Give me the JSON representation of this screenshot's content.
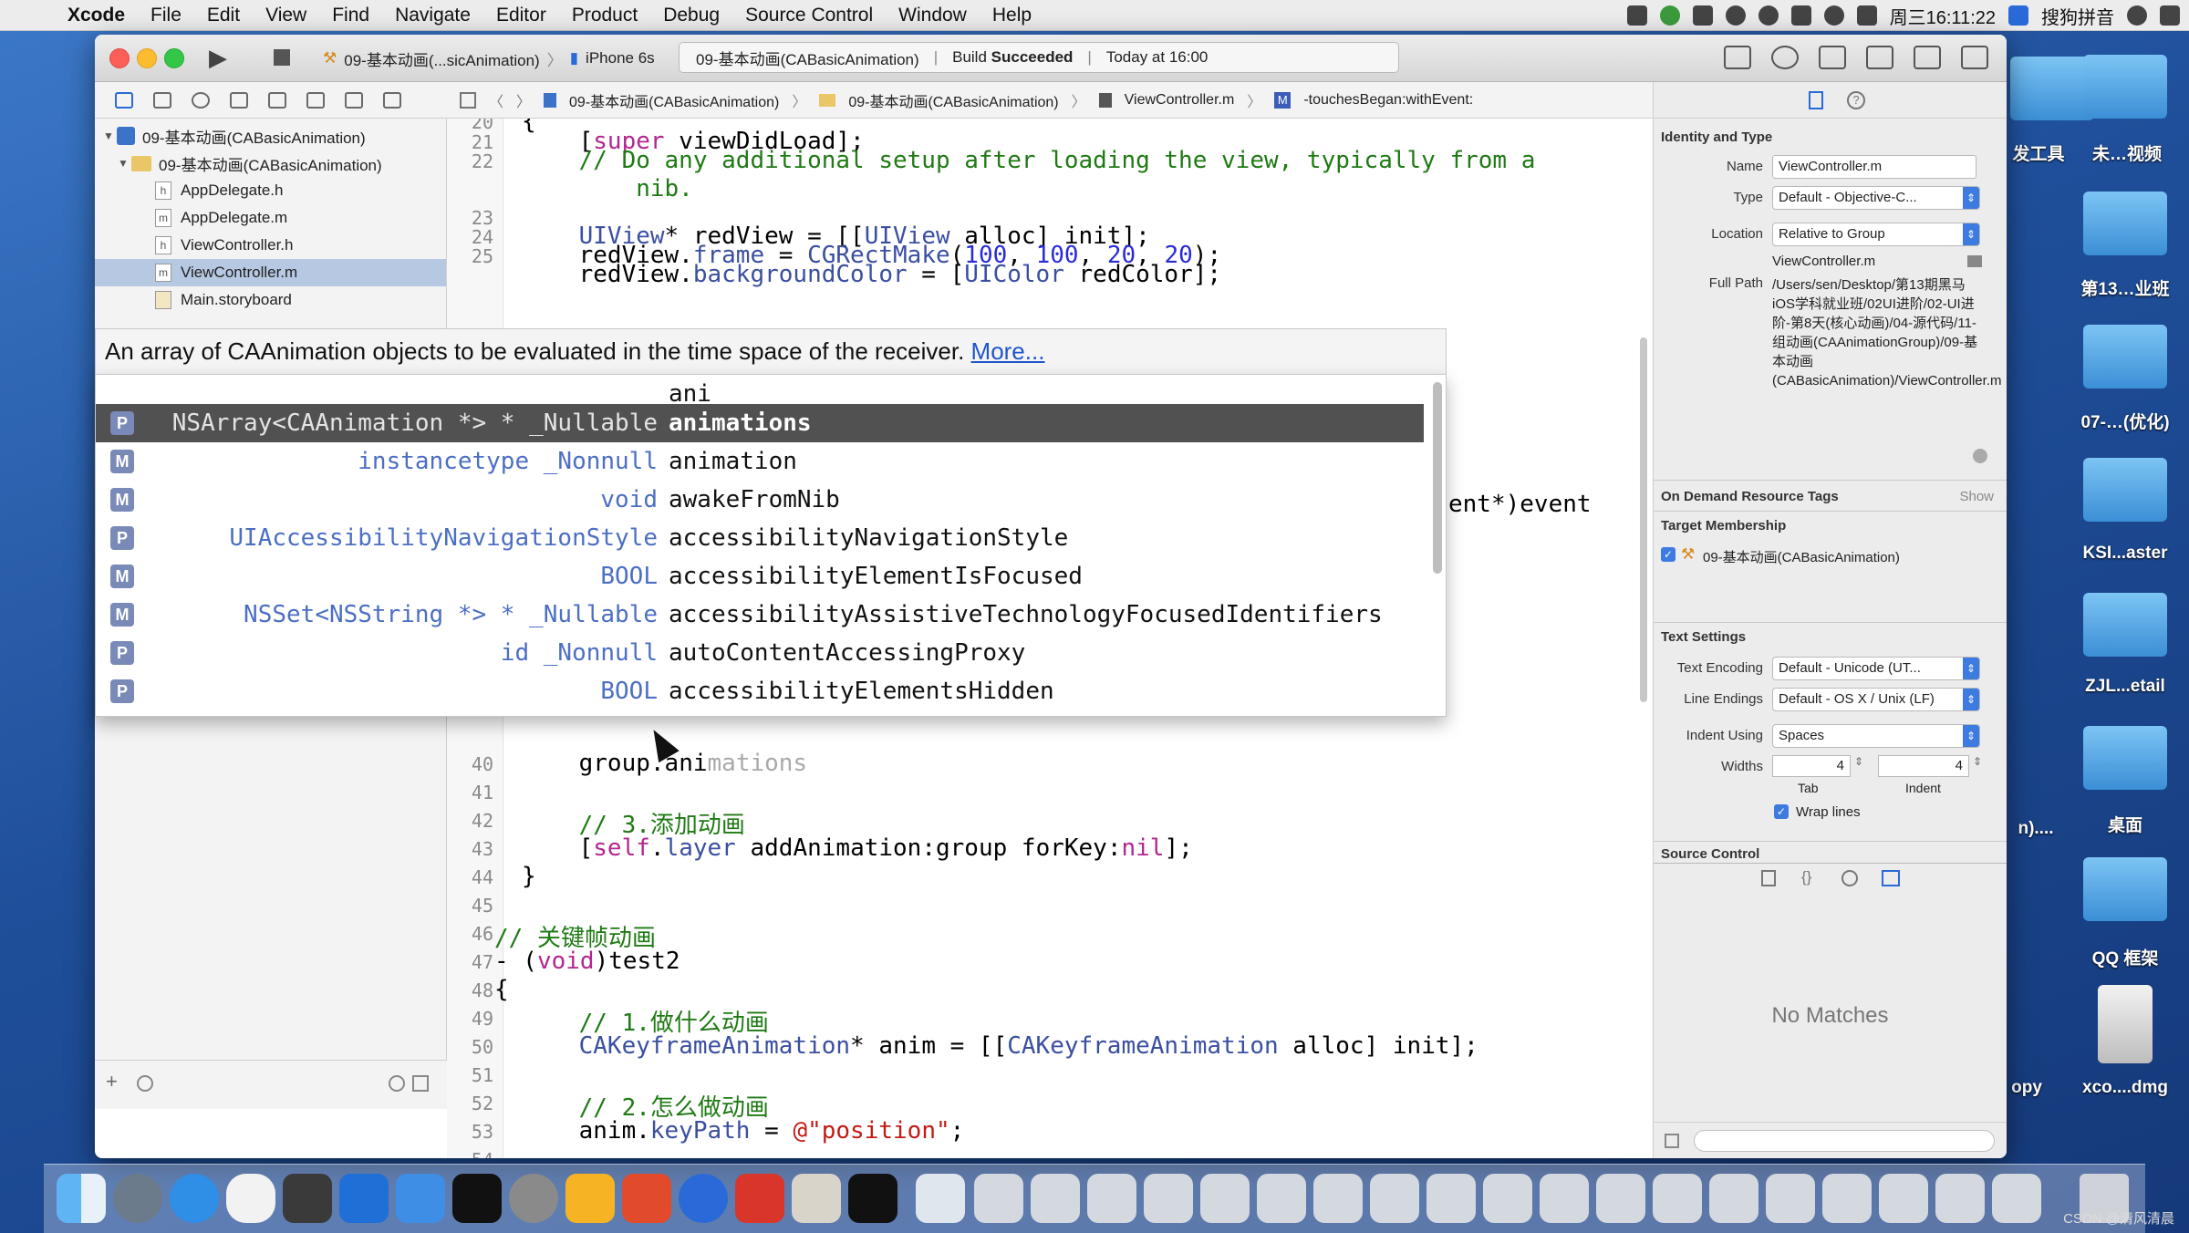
{
  "menubar": {
    "app": "Xcode",
    "items": [
      "File",
      "Edit",
      "View",
      "Find",
      "Navigate",
      "Editor",
      "Product",
      "Debug",
      "Source Control",
      "Window",
      "Help"
    ],
    "clock": "周三16:11:22",
    "input_method": "搜狗拼音"
  },
  "toolbar": {
    "scheme": "09-基本动画(...sicAnimation)",
    "device": "iPhone 6s",
    "activity_project": "09-基本动画(CABasicAnimation)",
    "activity_build": "Build",
    "activity_status": "Succeeded",
    "activity_time": "Today at 16:00"
  },
  "navigator": {
    "rows": [
      {
        "label": "09-基本动画(CABasicAnimation)",
        "kind": "project"
      },
      {
        "label": "09-基本动画(CABasicAnimation)",
        "kind": "folder"
      },
      {
        "label": "AppDelegate.h",
        "kind": "h"
      },
      {
        "label": "AppDelegate.m",
        "kind": "m"
      },
      {
        "label": "ViewController.h",
        "kind": "h"
      },
      {
        "label": "ViewController.m",
        "kind": "m"
      },
      {
        "label": "Main.storyboard",
        "kind": "sb"
      }
    ]
  },
  "jumpbar": {
    "crumbs": [
      "09-基本动画(CABasicAnimation)",
      "09-基本动画(CABasicAnimation)",
      "ViewController.m",
      "-touchesBegan:withEvent:"
    ]
  },
  "editor": {
    "line_numbers": [
      "20",
      "21",
      "22",
      "23",
      "24",
      "25",
      "40",
      "41",
      "42",
      "43",
      "44",
      "45",
      "46",
      "47",
      "48",
      "49",
      "50",
      "51",
      "52",
      "53",
      "54"
    ],
    "right_peek": "ent*)event",
    "line40_typed": "group.ani",
    "line40_ghost": "mations",
    "line42_comment": "// 3.添加动画",
    "line46_comment": "// 关键帧动画",
    "line49_comment": "// 1.做什么动画",
    "line52_comment": "// 2.怎么做动画"
  },
  "completion": {
    "help": "An array of CAAnimation objects to be evaluated in the time space of the receiver.",
    "help_link": "More...",
    "typed": "ani",
    "items": [
      {
        "kind": "P",
        "type": "NSArray<CAAnimation *> * _Nullable",
        "name": "animations"
      },
      {
        "kind": "M",
        "type": "instancetype _Nonnull",
        "name": "animation"
      },
      {
        "kind": "M",
        "type": "void",
        "name": "awakeFromNib"
      },
      {
        "kind": "P",
        "type": "UIAccessibilityNavigationStyle",
        "name": "accessibilityNavigationStyle"
      },
      {
        "kind": "M",
        "type": "BOOL",
        "name": "accessibilityElementIsFocused"
      },
      {
        "kind": "M",
        "type": "NSSet<NSString *> * _Nullable",
        "name": "accessibilityAssistiveTechnologyFocusedIdentifiers"
      },
      {
        "kind": "P",
        "type": "id _Nonnull",
        "name": "autoContentAccessingProxy"
      },
      {
        "kind": "P",
        "type": "BOOL",
        "name": "accessibilityElementsHidden"
      }
    ]
  },
  "inspector": {
    "identity_title": "Identity and Type",
    "name_label": "Name",
    "name_value": "ViewController.m",
    "type_label": "Type",
    "type_value": "Default - Objective-C...",
    "location_label": "Location",
    "location_value": "Relative to Group",
    "location_file": "ViewController.m",
    "fullpath_label": "Full Path",
    "fullpath_value": "/Users/sen/Desktop/第13期黑马iOS学科就业班/02UI进阶/02-UI进阶-第8天(核心动画)/04-源代码/11-组动画(CAAnimationGroup)/09-基本动画(CABasicAnimation)/ViewController.m",
    "ondemand_title": "On Demand Resource Tags",
    "ondemand_show": "Show",
    "target_title": "Target Membership",
    "target_item": "09-基本动画(CABasicAnimation)",
    "text_settings_title": "Text Settings",
    "encoding_label": "Text Encoding",
    "encoding_value": "Default - Unicode (UT...",
    "line_endings_label": "Line Endings",
    "line_endings_value": "Default - OS X / Unix (LF)",
    "indent_label": "Indent Using",
    "indent_value": "Spaces",
    "widths_label": "Widths",
    "tab_value": "4",
    "indent_width_value": "4",
    "tab_caption": "Tab",
    "indent_caption": "Indent",
    "wrap_label": "Wrap lines",
    "source_control_title": "Source Control",
    "no_matches": "No Matches"
  },
  "desktop": {
    "icons": [
      "发工具",
      "未…视频",
      "第13…业班",
      "07-…(优化)",
      "KSI...aster",
      "ZJL...etail",
      "桌面",
      "QQ 框架",
      "xco....dmg",
      "n)....",
      "opy"
    ]
  },
  "watermark": "CSDN @清风清晨",
  "colors": {
    "selection": "#515151",
    "link": "#1f56c9",
    "keyword": "#b3268f",
    "comment": "#1f7a14",
    "string": "#c41a16"
  }
}
